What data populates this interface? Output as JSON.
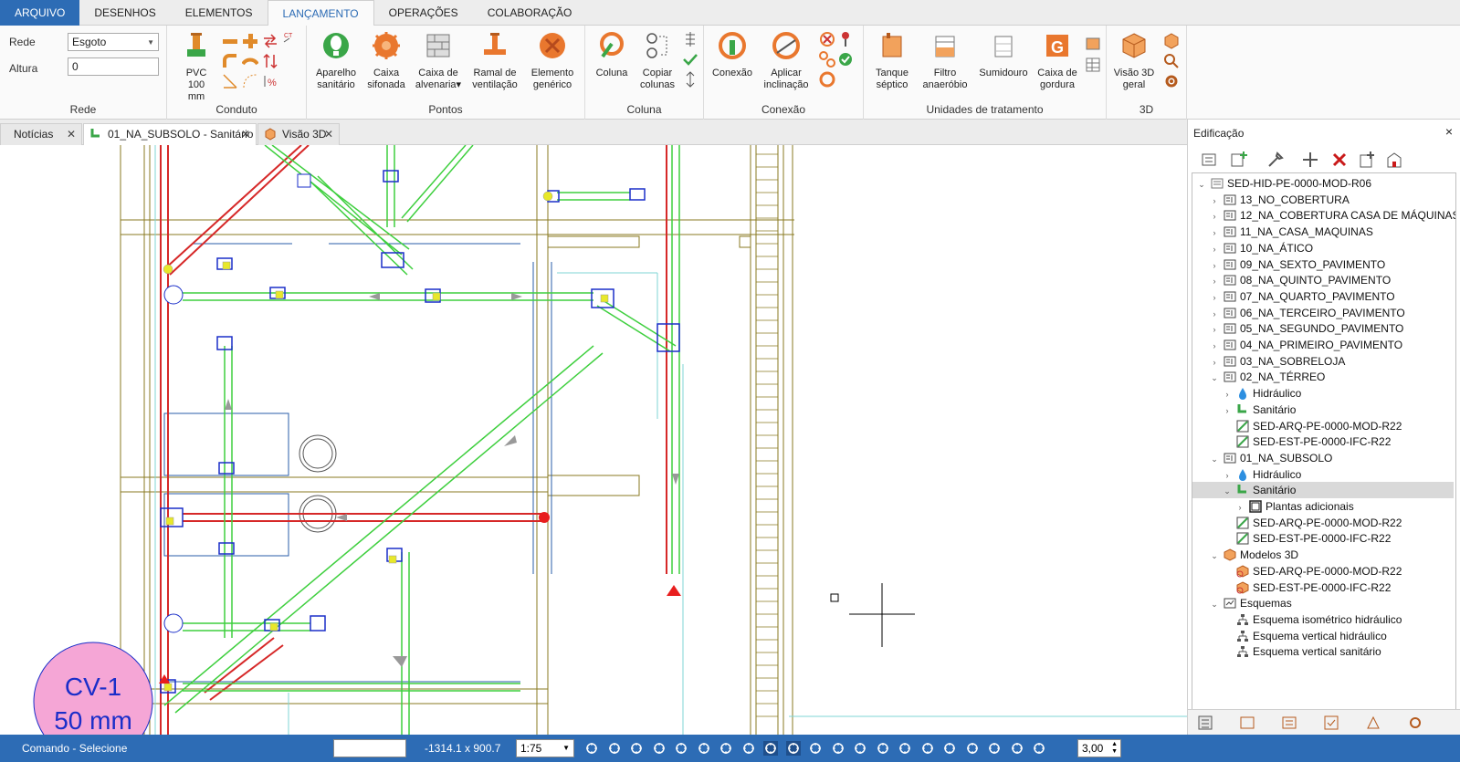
{
  "ribbon_tabs": [
    "ARQUIVO",
    "DESENHOS",
    "ELEMENTOS",
    "LANÇAMENTO",
    "OPERAÇÕES",
    "COLABORAÇÃO"
  ],
  "rede": {
    "rede_label": "Rede",
    "rede_value": "Esgoto",
    "altura_label": "Altura",
    "altura_value": "0",
    "group_label": "Rede"
  },
  "conduto": {
    "pvc_label": "PVC 100",
    "pvc_label2": "mm",
    "group_label": "Conduto"
  },
  "pontos": {
    "buttons": [
      {
        "l1": "Aparelho",
        "l2": "sanitário"
      },
      {
        "l1": "Caixa",
        "l2": "sifonada"
      },
      {
        "l1": "Caixa de",
        "l2": "alvenaria▾"
      },
      {
        "l1": "Ramal de",
        "l2": "ventilação"
      },
      {
        "l1": "Elemento",
        "l2": "genérico"
      }
    ],
    "group_label": "Pontos"
  },
  "coluna": {
    "buttons": [
      {
        "l1": "Coluna",
        "l2": ""
      },
      {
        "l1": "Copiar",
        "l2": "colunas"
      }
    ],
    "group_label": "Coluna"
  },
  "conexao": {
    "buttons": [
      {
        "l1": "Conexão",
        "l2": ""
      },
      {
        "l1": "Aplicar",
        "l2": "inclinação"
      }
    ],
    "group_label": "Conexão"
  },
  "tratamento": {
    "buttons": [
      {
        "l1": "Tanque",
        "l2": "séptico"
      },
      {
        "l1": "Filtro",
        "l2": "anaeróbio"
      },
      {
        "l1": "Sumidouro",
        "l2": ""
      },
      {
        "l1": "Caixa de",
        "l2": "gordura"
      }
    ],
    "group_label": "Unidades de tratamento"
  },
  "g3d": {
    "buttons": [
      {
        "l1": "Visão 3D",
        "l2": "geral"
      }
    ],
    "group_label": "3D"
  },
  "doc_tabs": [
    {
      "label": "Notícias"
    },
    {
      "label": "01_NA_SUBSOLO - Sanitário"
    },
    {
      "label": "Visão 3D"
    }
  ],
  "canvas": {
    "bubble_line1": "CV-1",
    "bubble_line2": "50 mm"
  },
  "panel": {
    "title": "Edificação",
    "close": "×",
    "tree": [
      {
        "label": "SED-HID-PE-0000-MOD-R06",
        "level": 0,
        "exp": "v",
        "icon": "project"
      },
      {
        "label": "13_NO_COBERTURA",
        "level": 1,
        "exp": ">",
        "icon": "floor"
      },
      {
        "label": "12_NA_COBERTURA CASA DE MÁQUINAS",
        "level": 1,
        "exp": ">",
        "icon": "floor"
      },
      {
        "label": "11_NA_CASA_MAQUINAS",
        "level": 1,
        "exp": ">",
        "icon": "floor"
      },
      {
        "label": "10_NA_ÁTICO",
        "level": 1,
        "exp": ">",
        "icon": "floor"
      },
      {
        "label": "09_NA_SEXTO_PAVIMENTO",
        "level": 1,
        "exp": ">",
        "icon": "floor"
      },
      {
        "label": "08_NA_QUINTO_PAVIMENTO",
        "level": 1,
        "exp": ">",
        "icon": "floor"
      },
      {
        "label": "07_NA_QUARTO_PAVIMENTO",
        "level": 1,
        "exp": ">",
        "icon": "floor"
      },
      {
        "label": "06_NA_TERCEIRO_PAVIMENTO",
        "level": 1,
        "exp": ">",
        "icon": "floor"
      },
      {
        "label": "05_NA_SEGUNDO_PAVIMENTO",
        "level": 1,
        "exp": ">",
        "icon": "floor"
      },
      {
        "label": "04_NA_PRIMEIRO_PAVIMENTO",
        "level": 1,
        "exp": ">",
        "icon": "floor"
      },
      {
        "label": "03_NA_SOBRELOJA",
        "level": 1,
        "exp": ">",
        "icon": "floor"
      },
      {
        "label": "02_NA_TÉRREO",
        "level": 1,
        "exp": "v",
        "icon": "floor"
      },
      {
        "label": "Hidráulico",
        "level": 2,
        "exp": ">",
        "icon": "water"
      },
      {
        "label": "Sanitário",
        "level": 2,
        "exp": ">",
        "icon": "sanitary"
      },
      {
        "label": "SED-ARQ-PE-0000-MOD-R22",
        "level": 2,
        "exp": "",
        "icon": "plan"
      },
      {
        "label": "SED-EST-PE-0000-IFC-R22",
        "level": 2,
        "exp": "",
        "icon": "plan"
      },
      {
        "label": "01_NA_SUBSOLO",
        "level": 1,
        "exp": "v",
        "icon": "floor"
      },
      {
        "label": "Hidráulico",
        "level": 2,
        "exp": ">",
        "icon": "water"
      },
      {
        "label": "Sanitário",
        "level": 2,
        "exp": "v",
        "icon": "sanitary",
        "selected": true
      },
      {
        "label": "Plantas adicionais",
        "level": 3,
        "exp": ">",
        "icon": "frame"
      },
      {
        "label": "SED-ARQ-PE-0000-MOD-R22",
        "level": 2,
        "exp": "",
        "icon": "plan"
      },
      {
        "label": "SED-EST-PE-0000-IFC-R22",
        "level": 2,
        "exp": "",
        "icon": "plan"
      },
      {
        "label": "Modelos 3D",
        "level": 1,
        "exp": "v",
        "icon": "models"
      },
      {
        "label": "SED-ARQ-PE-0000-MOD-R22",
        "level": 2,
        "exp": "",
        "icon": "model3d"
      },
      {
        "label": "SED-EST-PE-0000-IFC-R22",
        "level": 2,
        "exp": "",
        "icon": "model3d"
      },
      {
        "label": "Esquemas",
        "level": 1,
        "exp": "v",
        "icon": "schemes"
      },
      {
        "label": "Esquema isométrico hidráulico",
        "level": 2,
        "exp": "",
        "icon": "hier"
      },
      {
        "label": "Esquema vertical hidráulico",
        "level": 2,
        "exp": "",
        "icon": "hier"
      },
      {
        "label": "Esquema vertical sanitário",
        "level": 2,
        "exp": "",
        "icon": "hier"
      }
    ]
  },
  "status": {
    "command": "Comando - Selecione",
    "coords": "-1314.1 x 900.7",
    "scale": "1:75",
    "value": "3,00"
  }
}
